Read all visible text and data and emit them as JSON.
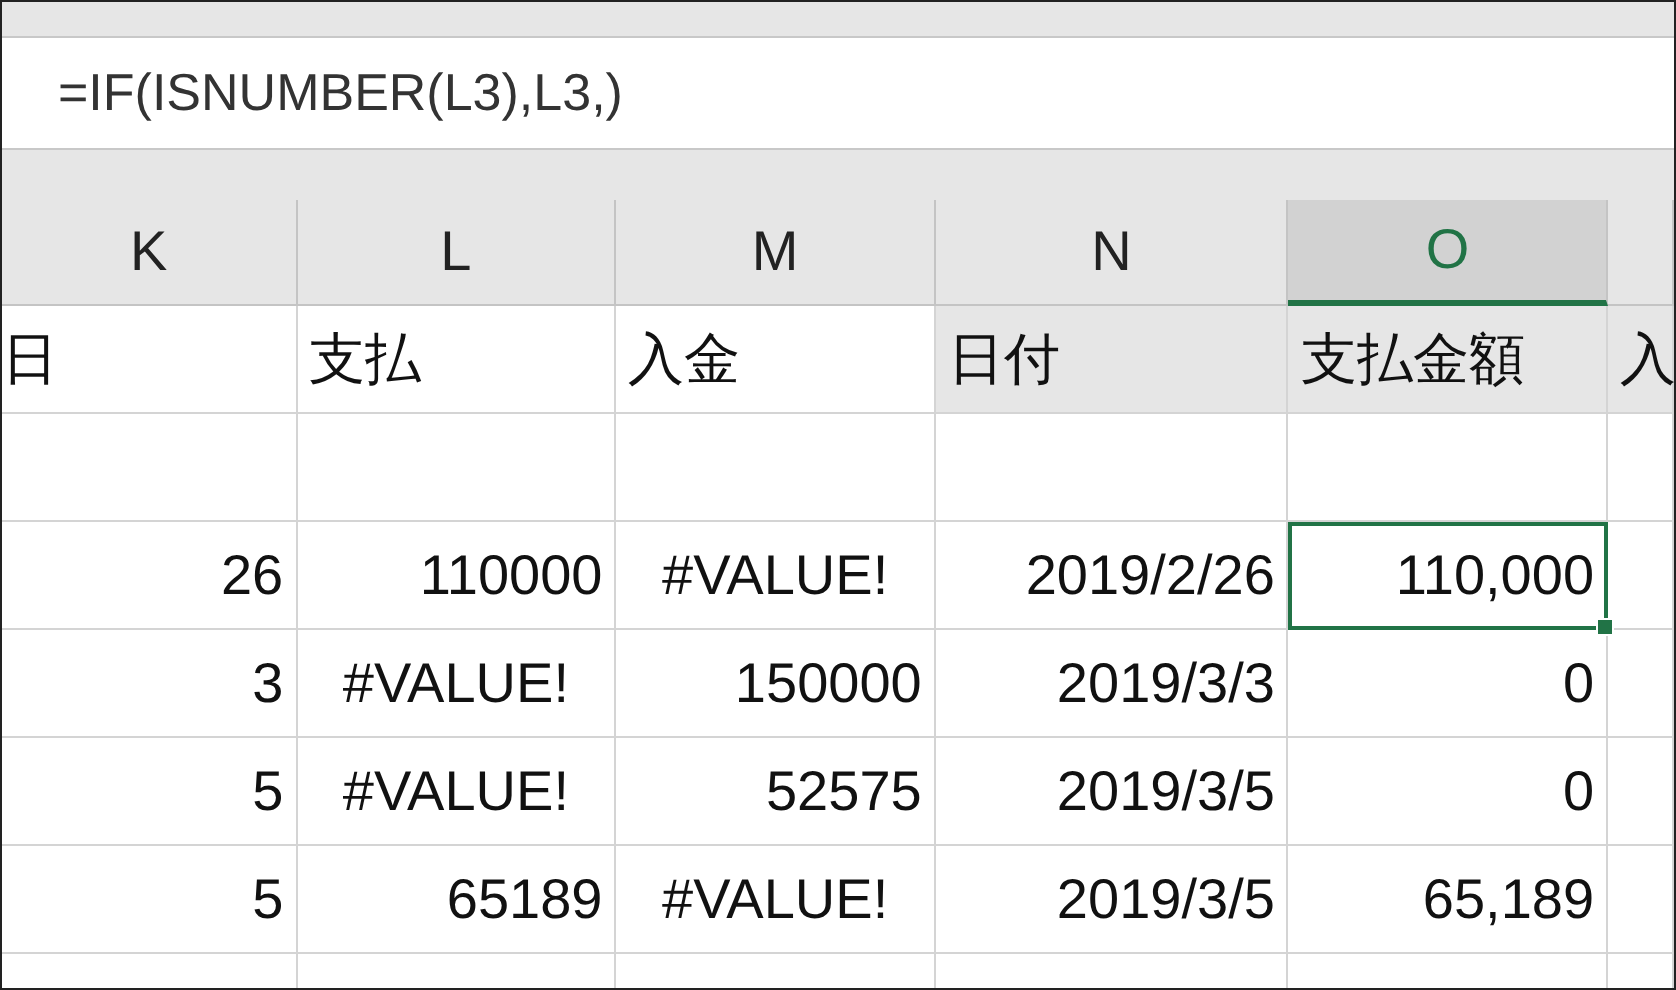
{
  "formula_bar": {
    "text": "=IF(ISNUMBER(L3),L3,)"
  },
  "columns": [
    {
      "label": "K",
      "selected": false
    },
    {
      "label": "L",
      "selected": false
    },
    {
      "label": "M",
      "selected": false
    },
    {
      "label": "N",
      "selected": false
    },
    {
      "label": "O",
      "selected": true
    },
    {
      "selected": false
    }
  ],
  "rows": [
    {
      "cells": [
        {
          "text": "日",
          "kind": "text",
          "shaded": false,
          "selected": false
        },
        {
          "text": "支払",
          "kind": "text",
          "shaded": false,
          "selected": false
        },
        {
          "text": "入金",
          "kind": "text",
          "shaded": false,
          "selected": false
        },
        {
          "text": "日付",
          "kind": "text",
          "shaded": true,
          "selected": false
        },
        {
          "text": "支払金額",
          "kind": "text",
          "shaded": true,
          "selected": false
        },
        {
          "text": "入",
          "kind": "text",
          "shaded": true,
          "selected": false
        }
      ]
    },
    {
      "cells": [
        {
          "text": "",
          "kind": "text",
          "shaded": false,
          "selected": false
        },
        {
          "text": "",
          "kind": "text",
          "shaded": false,
          "selected": false
        },
        {
          "text": "",
          "kind": "text",
          "shaded": false,
          "selected": false
        },
        {
          "text": "",
          "kind": "text",
          "shaded": false,
          "selected": false
        },
        {
          "text": "",
          "kind": "text",
          "shaded": false,
          "selected": false
        },
        {
          "text": "",
          "kind": "text",
          "shaded": false,
          "selected": false
        }
      ]
    },
    {
      "cells": [
        {
          "text": "26",
          "kind": "number",
          "shaded": false,
          "selected": false
        },
        {
          "text": "110000",
          "kind": "number",
          "shaded": false,
          "selected": false
        },
        {
          "text": "#VALUE!",
          "kind": "error",
          "shaded": false,
          "selected": false
        },
        {
          "text": "2019/2/26",
          "kind": "number",
          "shaded": false,
          "selected": false
        },
        {
          "text": "110,000",
          "kind": "number",
          "shaded": false,
          "selected": true
        },
        {
          "text": "",
          "kind": "text",
          "shaded": false,
          "selected": false
        }
      ]
    },
    {
      "cells": [
        {
          "text": "3",
          "kind": "number",
          "shaded": false,
          "selected": false
        },
        {
          "text": "#VALUE!",
          "kind": "error",
          "shaded": false,
          "selected": false
        },
        {
          "text": "150000",
          "kind": "number",
          "shaded": false,
          "selected": false
        },
        {
          "text": "2019/3/3",
          "kind": "number",
          "shaded": false,
          "selected": false
        },
        {
          "text": "0",
          "kind": "number",
          "shaded": false,
          "selected": false
        },
        {
          "text": "",
          "kind": "text",
          "shaded": false,
          "selected": false
        }
      ]
    },
    {
      "cells": [
        {
          "text": "5",
          "kind": "number",
          "shaded": false,
          "selected": false
        },
        {
          "text": "#VALUE!",
          "kind": "error",
          "shaded": false,
          "selected": false
        },
        {
          "text": "52575",
          "kind": "number",
          "shaded": false,
          "selected": false
        },
        {
          "text": "2019/3/5",
          "kind": "number",
          "shaded": false,
          "selected": false
        },
        {
          "text": "0",
          "kind": "number",
          "shaded": false,
          "selected": false
        },
        {
          "text": "",
          "kind": "text",
          "shaded": false,
          "selected": false
        }
      ]
    },
    {
      "cells": [
        {
          "text": "5",
          "kind": "number",
          "shaded": false,
          "selected": false
        },
        {
          "text": "65189",
          "kind": "number",
          "shaded": false,
          "selected": false
        },
        {
          "text": "#VALUE!",
          "kind": "error",
          "shaded": false,
          "selected": false
        },
        {
          "text": "2019/3/5",
          "kind": "number",
          "shaded": false,
          "selected": false
        },
        {
          "text": "65,189",
          "kind": "number",
          "shaded": false,
          "selected": false
        },
        {
          "text": "",
          "kind": "text",
          "shaded": false,
          "selected": false
        }
      ]
    }
  ]
}
